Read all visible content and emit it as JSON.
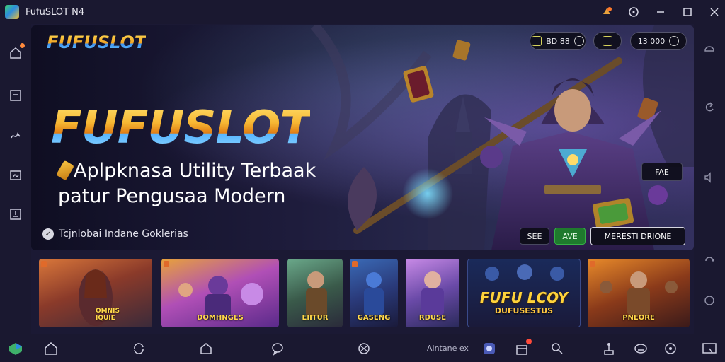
{
  "window": {
    "title": "FufuSLOT N4",
    "controls": [
      "notifications-icon",
      "help-icon",
      "minimize-icon",
      "maximize-icon",
      "close-icon"
    ]
  },
  "sidebar_left": {
    "icons": [
      "home-icon",
      "screen-icon",
      "shake-icon",
      "screenshot-icon",
      "media-icon"
    ]
  },
  "sidebar_right": {
    "icons": [
      "settings-icon",
      "back-icon",
      "volume-icon",
      "rotate-icon",
      "record-icon"
    ]
  },
  "hero": {
    "brand_small": "FUFUSLOT",
    "brand_big": "FUFUSLOT",
    "headline_line1": "Aplpknasa Utility Terbaak",
    "headline_line2": "patur Pengusaa Modern",
    "note": "Tcjnlobai Indane Goklerias",
    "pills": [
      {
        "label": "BD 88"
      },
      {
        "label": ""
      },
      {
        "label": "13 000"
      }
    ],
    "side_tag": "FAE",
    "bottom_tags": [
      {
        "label": "SEE"
      },
      {
        "label": "AVE"
      },
      {
        "label": "MERESTI DRIONE"
      }
    ]
  },
  "thumbnails": [
    {
      "label": "OMNIS\nIQUIE",
      "big_title": "",
      "subtitle": ""
    },
    {
      "label": "DOMHNGES",
      "big_title": "",
      "subtitle": ""
    },
    {
      "label": "EIITUR",
      "big_title": "",
      "subtitle": ""
    },
    {
      "label": "GASENG",
      "big_title": "",
      "subtitle": ""
    },
    {
      "label": "RDUSE",
      "big_title": "",
      "subtitle": ""
    },
    {
      "label": "",
      "big_title": "FUFU LCOY",
      "subtitle": "DUFUSESTUS"
    },
    {
      "label": "PNEORE",
      "big_title": "",
      "subtitle": ""
    }
  ],
  "bottombar": {
    "text": "Aintane ex",
    "icons": [
      "bluestacks-icon",
      "home-icon",
      "sync-icon",
      "house-icon",
      "chat-icon",
      "globe-icon",
      "game-icon",
      "gift-icon",
      "search-icon",
      "joystick-icon",
      "controller-icon",
      "face-icon",
      "multi-window-icon"
    ]
  },
  "colors": {
    "accent_gold": "#f7b733",
    "accent_blue": "#3a8ef0",
    "bg": "#1b1934"
  }
}
